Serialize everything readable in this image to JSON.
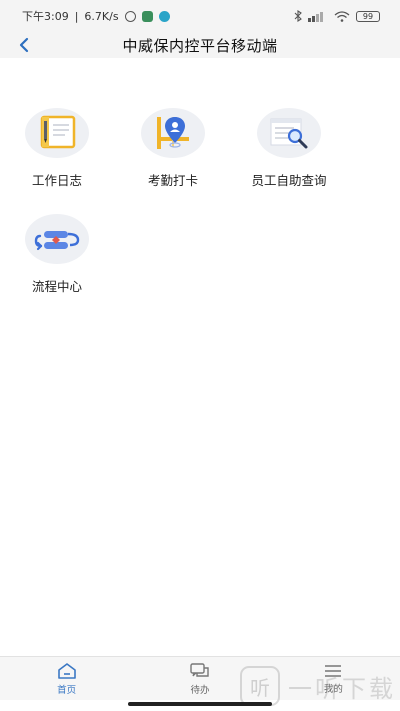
{
  "status_bar": {
    "time": "下午3:09",
    "speed": "6.7K/s",
    "battery": "99"
  },
  "header": {
    "title": "中威保内控平台移动端"
  },
  "modules": [
    {
      "label": "工作日志",
      "icon": "notebook-icon"
    },
    {
      "label": "考勤打卡",
      "icon": "location-pin-icon"
    },
    {
      "label": "员工自助查询",
      "icon": "document-search-icon"
    },
    {
      "label": "流程中心",
      "icon": "flow-icon"
    }
  ],
  "tabbar": {
    "items": [
      {
        "label": "首页",
        "icon": "home-icon",
        "active": true
      },
      {
        "label": "待办",
        "icon": "chat-icon",
        "active": false
      },
      {
        "label": "我的",
        "icon": "menu-icon",
        "active": false
      }
    ]
  },
  "watermark": {
    "logo_char": "听",
    "text": "一听下载"
  },
  "colors": {
    "accent": "#3b78c4",
    "icon_bg": "#eef0f4"
  }
}
